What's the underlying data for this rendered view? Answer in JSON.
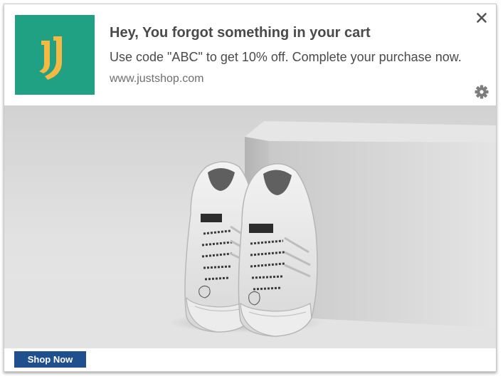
{
  "notification": {
    "title": "Hey, You forgot something in your cart",
    "message": "Use code \"ABC\" to get 10% off. Complete your purchase now.",
    "site": "www.justshop.com",
    "cta_label": "Shop Now"
  },
  "icons": {
    "logo": "juventus-style-j-logo",
    "close": "close-icon",
    "settings": "gear-icon"
  },
  "colors": {
    "logo_bg": "#21a183",
    "logo_mark": "#f4b942",
    "cta_bg": "#1f4f8f",
    "text": "#4a4a4a"
  }
}
